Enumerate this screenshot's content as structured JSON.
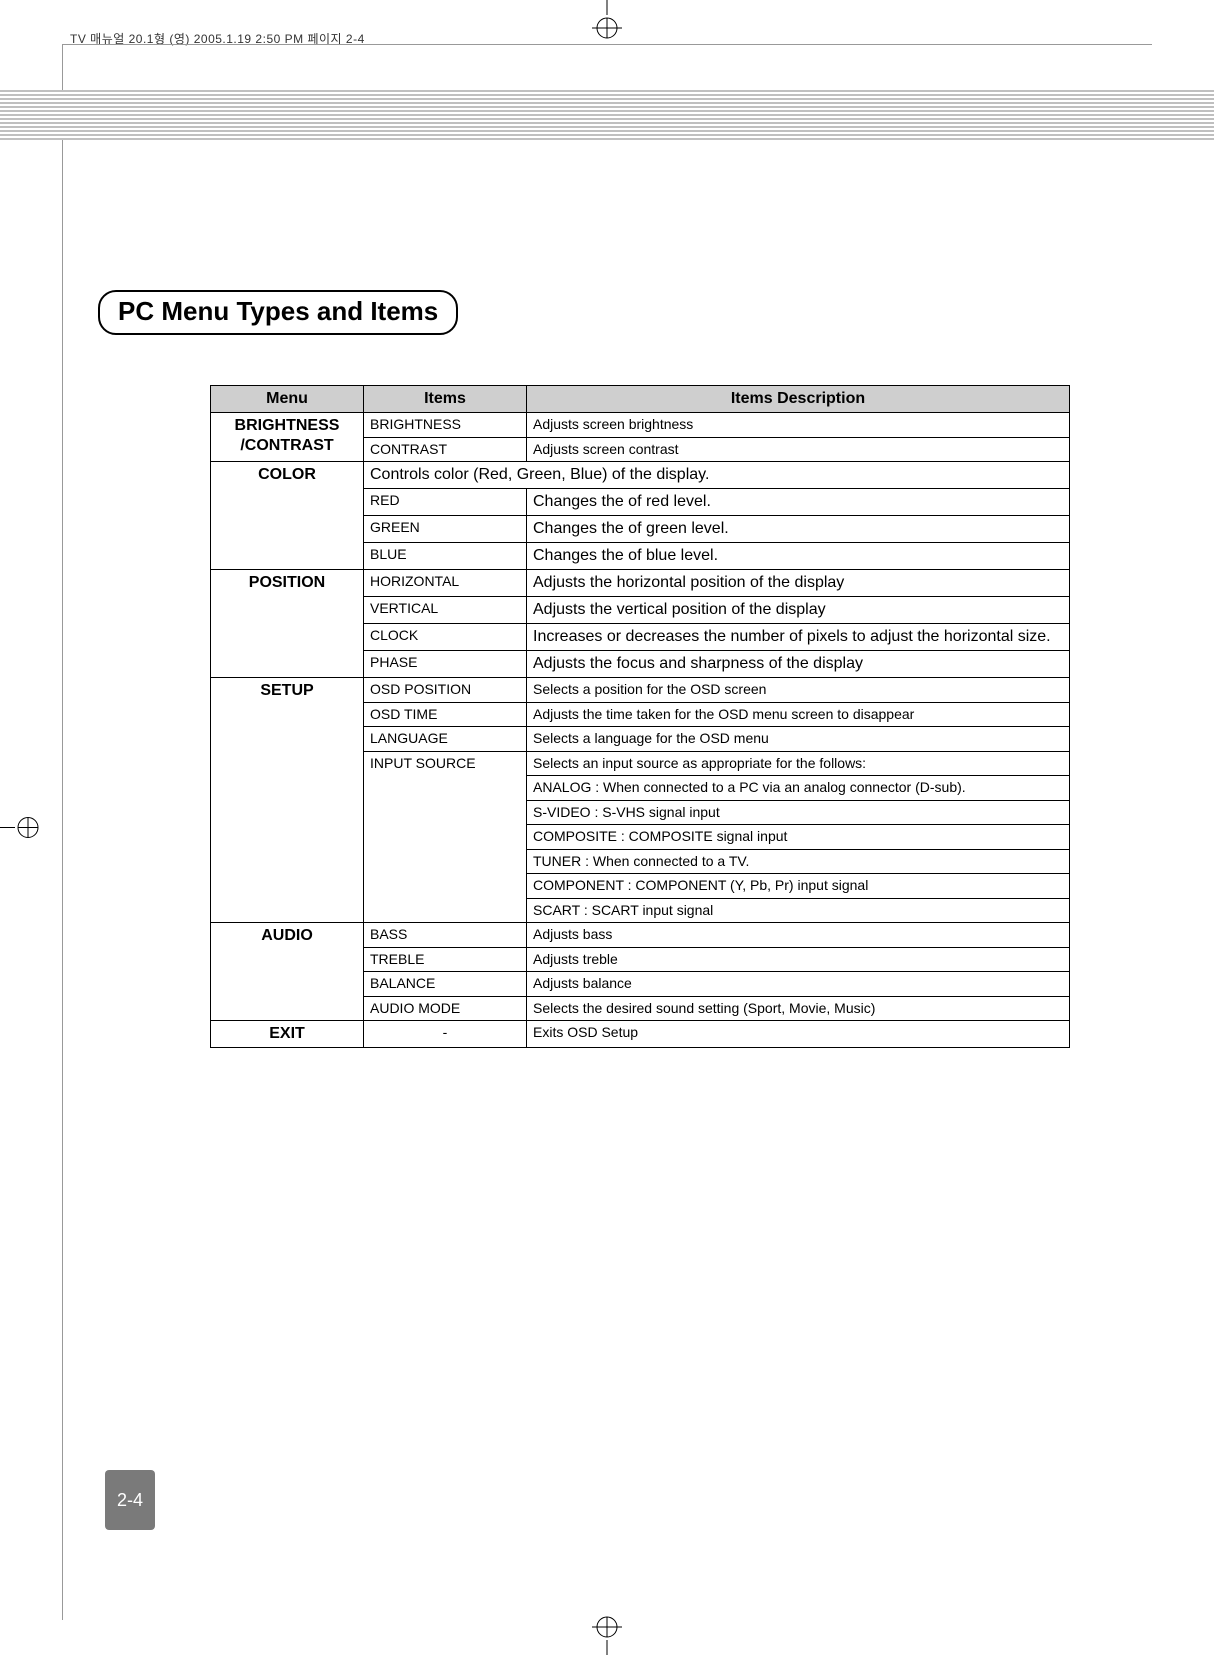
{
  "header_line": "TV 매뉴얼 20.1형 (영)  2005.1.19 2:50 PM  페이지 2-4",
  "heading": "PC Menu Types and Items",
  "columns": {
    "menu": "Menu",
    "items": "Items",
    "desc": "Items Description"
  },
  "sections": {
    "brightness_contrast": {
      "menu": "BRIGHTNESS /CONTRAST",
      "rows": [
        {
          "item": "BRIGHTNESS",
          "desc": "Adjusts screen brightness"
        },
        {
          "item": "CONTRAST",
          "desc": "Adjusts screen contrast"
        }
      ]
    },
    "color": {
      "menu": "COLOR",
      "group_desc": "Controls color (Red, Green, Blue) of the display.",
      "rows": [
        {
          "item": "RED",
          "desc": "Changes the of red level."
        },
        {
          "item": "GREEN",
          "desc": "Changes the of green level."
        },
        {
          "item": "BLUE",
          "desc": "Changes the of blue level."
        }
      ]
    },
    "position": {
      "menu": "POSITION",
      "rows": [
        {
          "item": "HORIZONTAL",
          "desc": "Adjusts the horizontal position of the display"
        },
        {
          "item": "VERTICAL",
          "desc": "Adjusts the vertical position of the display"
        },
        {
          "item": "CLOCK",
          "desc": "Increases or decreases the number of pixels to adjust the horizontal size."
        },
        {
          "item": "PHASE",
          "desc": "Adjusts the focus and sharpness of the display"
        }
      ]
    },
    "setup": {
      "menu": "SETUP",
      "rows": [
        {
          "item": "OSD POSITION",
          "desc": "Selects a position for the OSD screen"
        },
        {
          "item": "OSD TIME",
          "desc": "Adjusts the time taken for the OSD menu screen to disappear"
        },
        {
          "item": "LANGUAGE",
          "desc": "Selects a language for the OSD menu"
        }
      ],
      "input_source": {
        "item": "INPUT SOURCE",
        "desc": "Selects an input source as appropriate for the follows:",
        "options": [
          "ANALOG : When connected to a PC via an analog connector (D-sub).",
          "S-VIDEO : S-VHS signal input",
          "COMPOSITE : COMPOSITE signal input",
          "TUNER : When connected to a TV.",
          "COMPONENT : COMPONENT (Y, Pb, Pr) input signal",
          "SCART : SCART input signal"
        ]
      }
    },
    "audio": {
      "menu": "AUDIO",
      "rows": [
        {
          "item": "BASS",
          "desc": "Adjusts bass"
        },
        {
          "item": "TREBLE",
          "desc": "Adjusts treble"
        },
        {
          "item": "BALANCE",
          "desc": "Adjusts balance"
        },
        {
          "item": "AUDIO MODE",
          "desc": "Selects the desired sound setting (Sport, Movie, Music)"
        }
      ]
    },
    "exit": {
      "menu": "EXIT",
      "item": "-",
      "desc": "Exits OSD Setup"
    }
  },
  "page_number": "2-4"
}
